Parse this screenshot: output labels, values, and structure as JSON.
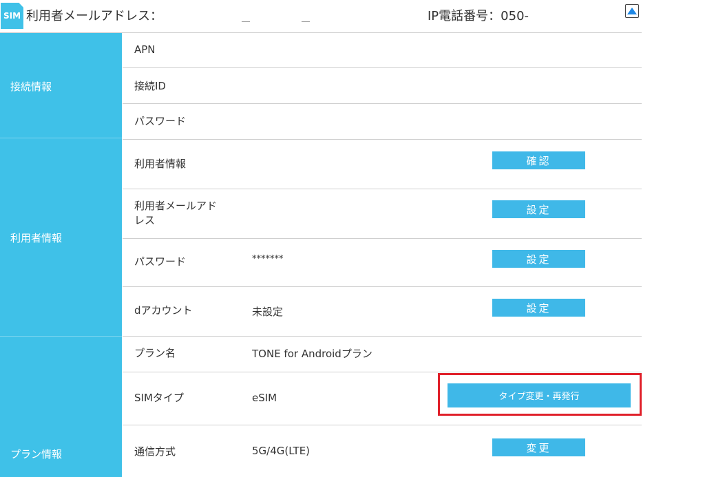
{
  "header": {
    "sim_badge": "SIM",
    "email_label": "利用者メールアドレス：",
    "ip_phone_label": "IP電話番号：050-",
    "scroll_top_icon": "triangle-up-icon"
  },
  "sections": {
    "connection": {
      "label": "接続情報",
      "rows": [
        {
          "label": "APN",
          "value": ""
        },
        {
          "label": "接続ID",
          "value": ""
        },
        {
          "label": "パスワード",
          "value": ""
        }
      ]
    },
    "user": {
      "label": "利用者情報",
      "rows": [
        {
          "label": "利用者情報",
          "value": "",
          "button": "確認"
        },
        {
          "label": "利用者メールアド\nレス",
          "label_line1": "利用者メールアド",
          "label_line2": "レス",
          "value": "",
          "button": "設定"
        },
        {
          "label": "パスワード",
          "value": "*******",
          "button": "設定"
        },
        {
          "label": "dアカウント",
          "value": "未設定",
          "button": "設定"
        }
      ]
    },
    "plan": {
      "label": "プラン情報",
      "rows": [
        {
          "label": "プラン名",
          "value": "TONE for Androidプラン"
        },
        {
          "label": "SIMタイプ",
          "value": "eSIM",
          "button": "タイプ変更・再発行"
        },
        {
          "label": "通信方式",
          "value": "5G/4G(LTE)",
          "button": "変更"
        }
      ]
    }
  },
  "colors": {
    "accent": "#3fc1e8",
    "button": "#3fb8e8",
    "highlight": "#e0202a"
  }
}
